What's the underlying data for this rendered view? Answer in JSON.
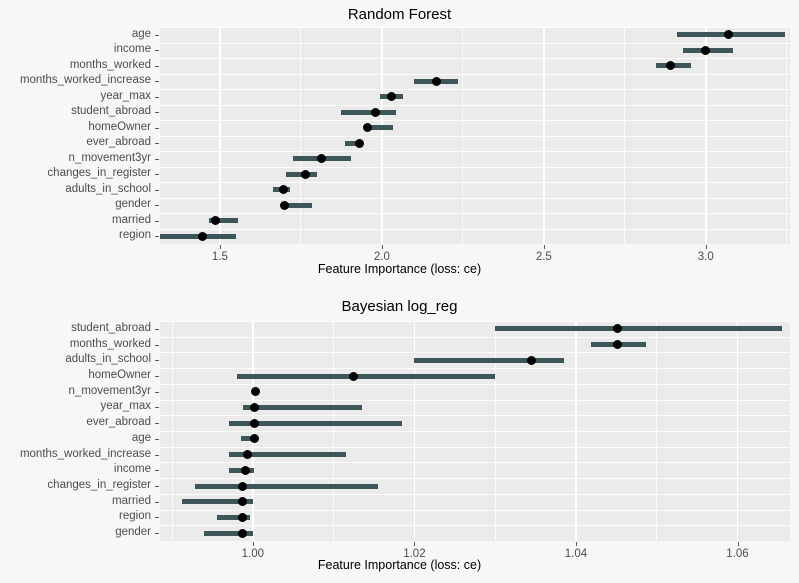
{
  "colors": {
    "panel_background": "#EBEBEB",
    "page_background": "#F7F7F7",
    "gridline": "#FFFFFF",
    "interval_bar": "#3C5659",
    "point": "#000000",
    "axis_text": "#4D4D4D",
    "title_text": "#000000"
  },
  "charts": [
    {
      "id": "random-forest",
      "title": "Random Forest",
      "xlabel": "Feature Importance (loss: ce)",
      "ylabel": "",
      "xticks": [
        "1.5",
        "2.0",
        "2.5",
        "3.0"
      ],
      "xtick_values": [
        1.5,
        2.0,
        2.5,
        3.0
      ],
      "xlim": [
        1.315,
        3.26
      ],
      "features": [
        "age",
        "income",
        "months_worked",
        "months_worked_increase",
        "year_max",
        "student_abroad",
        "homeOwner",
        "ever_abroad",
        "n_movement3yr",
        "changes_in_register",
        "adults_in_school",
        "gender",
        "married",
        "region"
      ],
      "points": [
        3.07,
        3.0,
        2.89,
        2.17,
        2.03,
        1.98,
        1.955,
        1.93,
        1.815,
        1.765,
        1.695,
        1.7,
        1.485,
        1.445
      ],
      "lower": [
        2.91,
        2.93,
        2.845,
        2.1,
        1.995,
        1.875,
        1.95,
        1.885,
        1.725,
        1.705,
        1.665,
        1.695,
        1.465,
        1.315
      ],
      "upper": [
        3.245,
        3.085,
        2.955,
        2.235,
        2.065,
        2.045,
        2.035,
        1.94,
        1.905,
        1.8,
        1.715,
        1.785,
        1.555,
        1.55
      ]
    },
    {
      "id": "bayesian-log-reg",
      "title": "Bayesian log_reg",
      "xlabel": "Feature Importance (loss: ce)",
      "ylabel": "",
      "xticks": [
        "1.00",
        "1.02",
        "1.04",
        "1.06"
      ],
      "xtick_values": [
        1.0,
        1.02,
        1.04,
        1.06
      ],
      "xlim": [
        0.9885,
        1.0665
      ],
      "features": [
        "student_abroad",
        "months_worked",
        "adults_in_school",
        "homeOwner",
        "n_movement3yr",
        "year_max",
        "ever_abroad",
        "age",
        "months_worked_increase",
        "income",
        "changes_in_register",
        "married",
        "region",
        "gender"
      ],
      "points": [
        1.0452,
        1.0452,
        1.0345,
        1.0125,
        1.0003,
        1.0002,
        1.0002,
        1.0002,
        0.9993,
        0.9991,
        0.9987,
        0.9987,
        0.9987,
        0.9987
      ],
      "lower": [
        1.03,
        1.0418,
        1.02,
        0.998,
        1.0003,
        0.9988,
        0.997,
        0.9985,
        0.997,
        0.997,
        0.9928,
        0.9912,
        0.9955,
        0.994
      ],
      "upper": [
        1.0655,
        1.0487,
        1.0385,
        1.03,
        1.0003,
        1.0135,
        1.0185,
        1.0005,
        1.0115,
        1.0002,
        1.0155,
        1.0,
        0.9997,
        1.0
      ]
    }
  ]
}
